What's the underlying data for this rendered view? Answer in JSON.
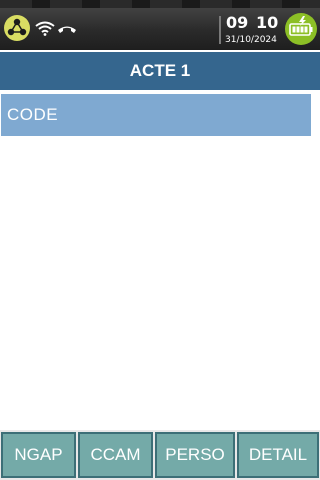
{
  "status_bar": {
    "icons": {
      "terminal": "terminal-network-icon",
      "wifi": "wifi-icon",
      "phone": "phone-hangup-icon",
      "battery": "battery-charging-icon"
    },
    "time_hours": "09",
    "time_minutes": "10",
    "date": "31/10/2024"
  },
  "header": {
    "title": "ACTE 1"
  },
  "form": {
    "code_label": "CODE"
  },
  "bottom_nav": {
    "ngap_label": "NGAP",
    "ccam_label": "CCAM",
    "perso_label": "PERSO",
    "detail_label": "DETAIL"
  },
  "colors": {
    "title_bar": "#35668e",
    "code_field": "#7fa9d1",
    "nav_button": "#74aaa8",
    "battery": "#8cbf26"
  }
}
